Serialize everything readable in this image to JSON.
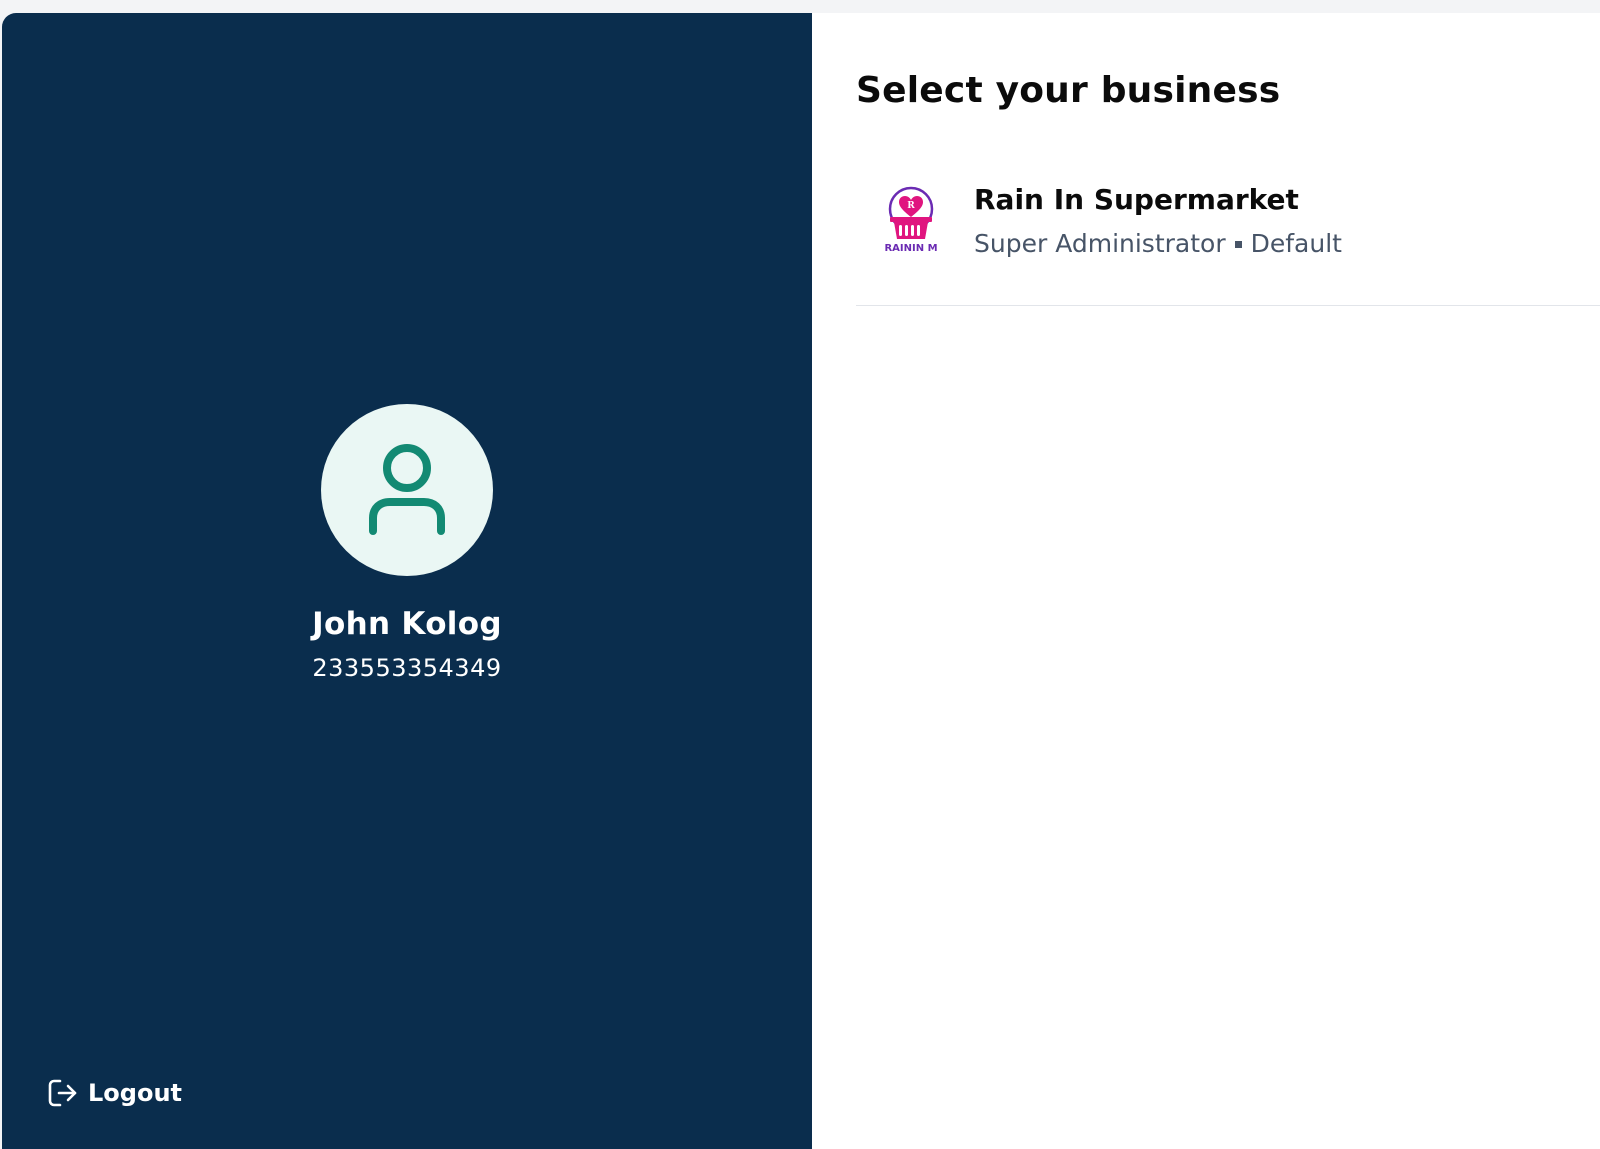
{
  "colors": {
    "sidebar_bg": "#0a2d4d",
    "avatar_bg": "#eaf7f4",
    "avatar_icon": "#138a73",
    "logo_pink": "#e0157f",
    "logo_purple": "#6b2bb3"
  },
  "sidebar": {
    "avatar_icon": "user-icon",
    "user_name": "John Kolog",
    "user_phone": "233553354349",
    "logout_icon": "logout-icon",
    "logout_label": "Logout"
  },
  "main": {
    "title": "Select your business",
    "businesses": [
      {
        "name": "Rain In Supermarket",
        "role": "Super Administrator",
        "status": "Default",
        "logo_text": "RAININ M"
      }
    ]
  }
}
